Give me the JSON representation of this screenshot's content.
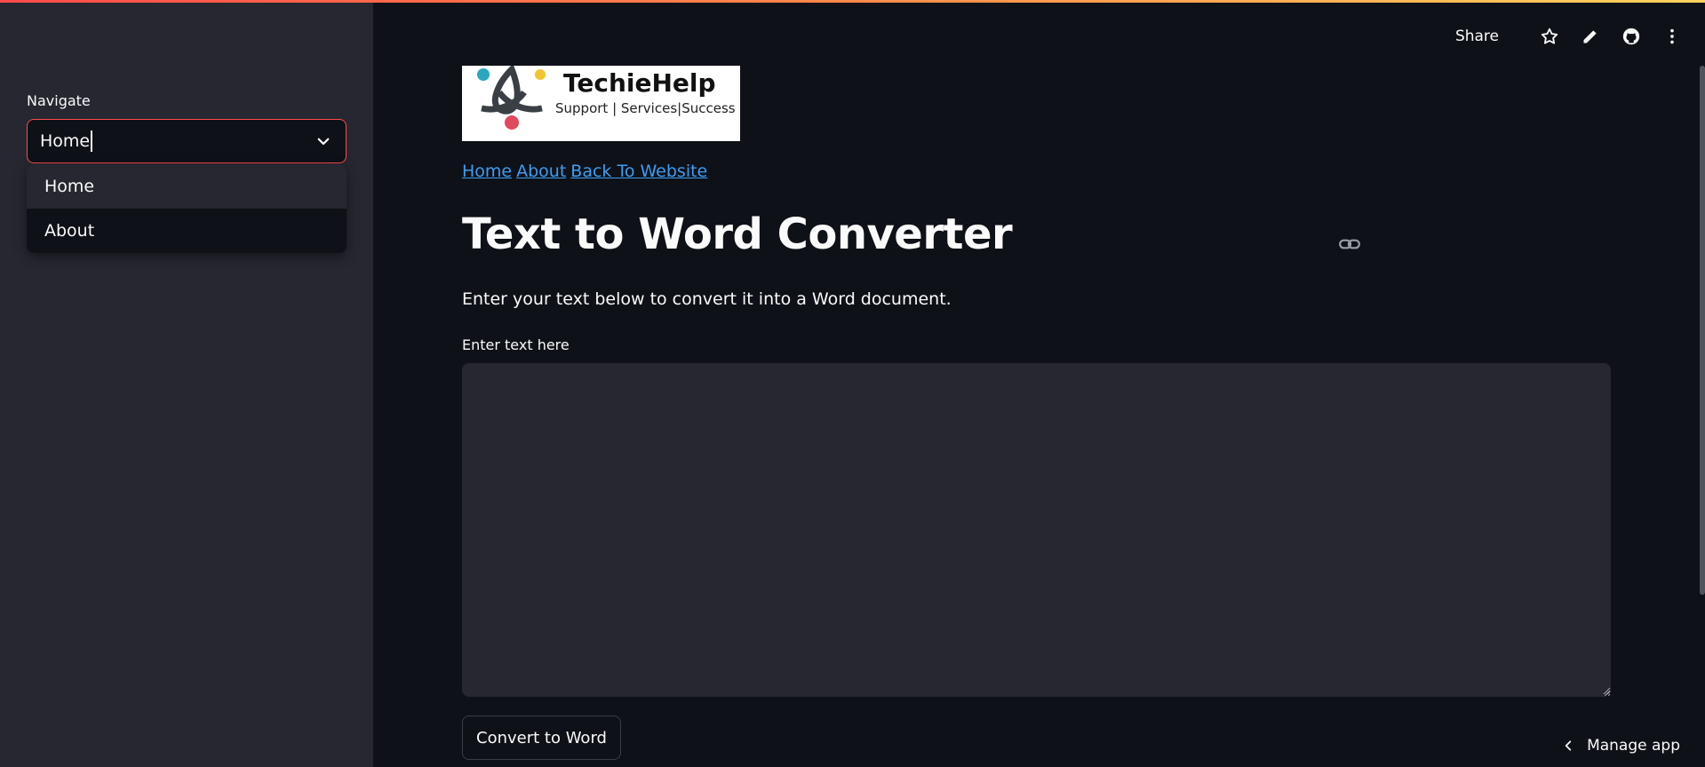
{
  "sidebar": {
    "nav_label": "Navigate",
    "select_value": "Home",
    "options": [
      {
        "label": "Home",
        "active": true
      },
      {
        "label": "About",
        "active": false
      }
    ]
  },
  "header": {
    "share_label": "Share",
    "icons": [
      "star-icon",
      "pencil-icon",
      "github-icon",
      "more-vertical-icon"
    ]
  },
  "logo": {
    "name": "TechieHelp",
    "tagline": "Support | Services|Success"
  },
  "links": {
    "home": "Home",
    "about": "About",
    "back": "Back To Website"
  },
  "main": {
    "title": "Text to Word Converter",
    "subtitle": "Enter your text below to convert it into a Word document.",
    "field_label": "Enter text here",
    "field_value": "",
    "convert_label": "Convert to Word"
  },
  "footer": {
    "manage_label": "Manage app"
  },
  "colors": {
    "background": "#0e1117",
    "sidebar": "#262730",
    "accent": "#ff4b4b",
    "link": "#3d9df3"
  }
}
